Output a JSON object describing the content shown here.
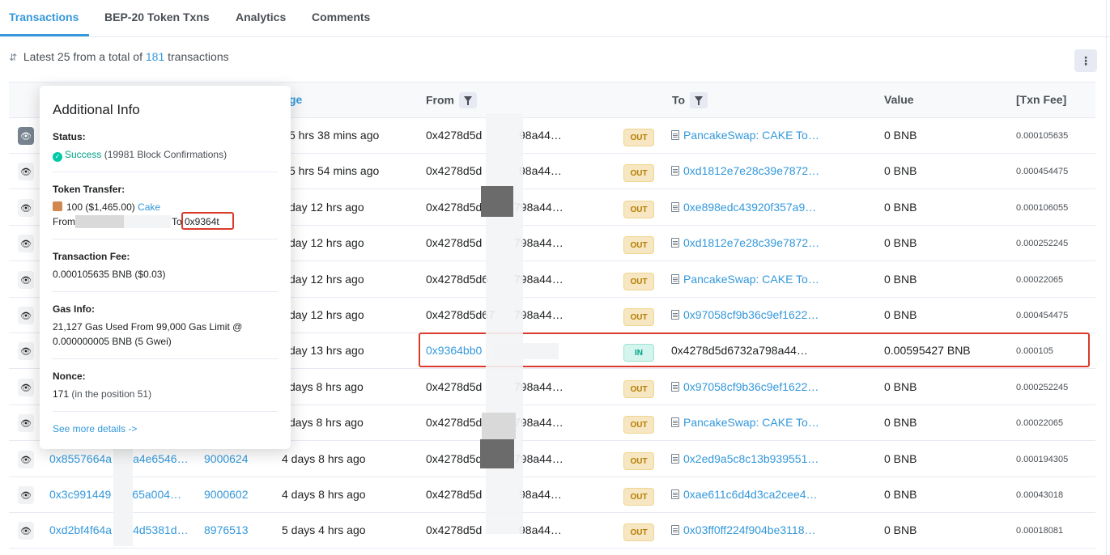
{
  "tabs": [
    "Transactions",
    "BEP-20 Token Txns",
    "Analytics",
    "Comments"
  ],
  "summary": {
    "prefix": "Latest 25 from a total of",
    "count": "181",
    "suffix": "transactions"
  },
  "columns": {
    "age": "ge",
    "from": "From",
    "to": "To",
    "value": "Value",
    "fee": "[Txn Fee]"
  },
  "rows": [
    {
      "hash": "",
      "block": "",
      "age": "5 hrs 38 mins ago",
      "from": "0x4278d5d",
      "from_tail": "98a44…",
      "dir": "OUT",
      "to": "PancakeSwap: CAKE To…",
      "to_link": true,
      "value": "0 BNB",
      "fee": "0.000105635"
    },
    {
      "hash": "",
      "block": "",
      "age": "5 hrs 54 mins ago",
      "from": "0x4278d5d",
      "from_tail": "98a44…",
      "dir": "OUT",
      "to": "0xd1812e7e28c39e7872…",
      "to_link": true,
      "value": "0 BNB",
      "fee": "0.000454475"
    },
    {
      "hash": "",
      "block": "",
      "age": "day 12 hrs ago",
      "from": "0x4278d5d",
      "from_tail": "798a44…",
      "dir": "OUT",
      "to": "0xe898edc43920f357a9…",
      "to_link": true,
      "value": "0 BNB",
      "fee": "0.000106055"
    },
    {
      "hash": "",
      "block": "",
      "age": "day 12 hrs ago",
      "from": "0x4278d5d",
      "from_tail": "798a44…",
      "dir": "OUT",
      "to": "0xd1812e7e28c39e7872…",
      "to_link": true,
      "value": "0 BNB",
      "fee": "0.000252245"
    },
    {
      "hash": "",
      "block": "",
      "age": "day 12 hrs ago",
      "from": "0x4278d5d6",
      "from_tail": "798a44…",
      "dir": "OUT",
      "to": "PancakeSwap: CAKE To…",
      "to_link": true,
      "value": "0 BNB",
      "fee": "0.00022065"
    },
    {
      "hash": "",
      "block": "",
      "age": "day 12 hrs ago",
      "from": "0x4278d5d67",
      "from_tail": "798a44…",
      "dir": "OUT",
      "to": "0x97058cf9b36c9ef1622…",
      "to_link": true,
      "value": "0 BNB",
      "fee": "0.000454475"
    },
    {
      "hash": "",
      "block": "",
      "age": "day 13 hrs ago",
      "from": "0x9364bb0",
      "from_tail": "",
      "dir": "IN",
      "to": "0x4278d5d6732a798a44…",
      "to_link": false,
      "value": "0.00595427 BNB",
      "fee": "0.000105"
    },
    {
      "hash": "",
      "block": "",
      "age": "days 8 hrs ago",
      "from": "0x4278d5d",
      "from_tail": "798a44…",
      "dir": "OUT",
      "to": "0x97058cf9b36c9ef1622…",
      "to_link": true,
      "value": "0 BNB",
      "fee": "0.000252245"
    },
    {
      "hash": "",
      "block": "",
      "age": "days 8 hrs ago",
      "from": "0x4278d5d",
      "from_tail": "798a44…",
      "dir": "OUT",
      "to": "PancakeSwap: CAKE To…",
      "to_link": true,
      "value": "0 BNB",
      "fee": "0.00022065"
    },
    {
      "hash": "0x8557664a",
      "hash_tail": "a4e6546…",
      "block": "9000624",
      "age": "4 days 8 hrs ago",
      "from": "0x4278d5d",
      "from_tail": "798a44…",
      "dir": "OUT",
      "to": "0x2ed9a5c8c13b939551…",
      "to_link": true,
      "value": "0 BNB",
      "fee": "0.000194305"
    },
    {
      "hash": "0x3c991449",
      "hash_tail": "65a004…",
      "block": "9000602",
      "age": "4 days 8 hrs ago",
      "from": "0x4278d5d",
      "from_tail": "98a44…",
      "dir": "OUT",
      "to": "0xae611c6d4d3ca2cee4…",
      "to_link": true,
      "value": "0 BNB",
      "fee": "0.00043018"
    },
    {
      "hash": "0xd2bf4f64a",
      "hash_tail": "4d5381d…",
      "block": "8976513",
      "age": "5 days 4 hrs ago",
      "from": "0x4278d5d",
      "from_tail": "98a44…",
      "dir": "OUT",
      "to": "0x03ff0ff224f904be3118…",
      "to_link": true,
      "value": "0 BNB",
      "fee": "0.00018081"
    }
  ],
  "popup": {
    "title": "Additional Info",
    "status_label": "Status:",
    "status_value": "Success",
    "status_detail": "(19981 Block Confirmations)",
    "token_label": "Token Transfer:",
    "token_amount": "100 ($1,465.00)",
    "token_name": "Cake",
    "token_from": "From",
    "token_to": "To",
    "token_to_addr": "0x9364t",
    "fee_label": "Transaction Fee:",
    "fee_value": "0.000105635 BNB ($0.03)",
    "gas_label": "Gas Info:",
    "gas_line1": "21,127 Gas Used From 99,000 Gas Limit @",
    "gas_line2": "0.000000005 BNB (5 Gwei)",
    "nonce_label": "Nonce:",
    "nonce_value": "171",
    "nonce_detail": "(in the position 51)",
    "see_more": "See more details ->"
  },
  "colors": {
    "accent": "#3498db",
    "out_badge": "#f7e6c2",
    "in_badge": "#d4f4ee",
    "highlight": "#d93a2b",
    "success": "#00c9a7"
  }
}
